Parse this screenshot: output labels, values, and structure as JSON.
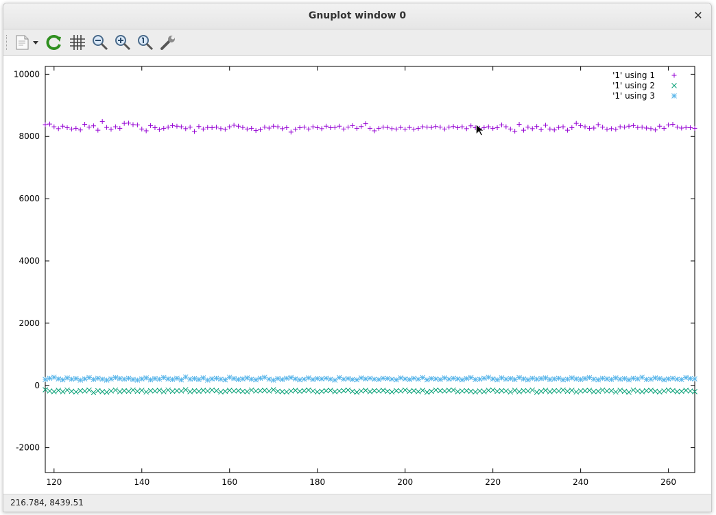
{
  "window": {
    "title": "Gnuplot window 0",
    "close_icon": "close-icon"
  },
  "toolbar": {
    "items": [
      {
        "name": "copy-clipboard-button",
        "icon": "clipboard-icon"
      },
      {
        "name": "replot-button",
        "icon": "refresh-icon"
      },
      {
        "name": "toggle-grid-button",
        "icon": "grid-icon"
      },
      {
        "name": "zoom-previous-button",
        "icon": "zoom-out-icon"
      },
      {
        "name": "zoom-next-button",
        "icon": "zoom-in-icon"
      },
      {
        "name": "autoscale-button",
        "icon": "zoom-reset-icon"
      },
      {
        "name": "settings-button",
        "icon": "wrench-icon"
      }
    ]
  },
  "status": {
    "coords": "216.784,  8439.51"
  },
  "chart_data": {
    "type": "scatter",
    "title": "",
    "xlabel": "",
    "ylabel": "",
    "xlim": [
      118,
      266
    ],
    "ylim": [
      -2800,
      10250
    ],
    "xticks": [
      120,
      140,
      160,
      180,
      200,
      220,
      240,
      260
    ],
    "yticks": [
      -2000,
      0,
      2000,
      4000,
      6000,
      8000,
      10000
    ],
    "legend_position": "top-right",
    "grid": false,
    "series": [
      {
        "name": "'1' using 1",
        "marker": "+",
        "color": "#9400d3",
        "x_start": 118,
        "x_step": 1,
        "approx_mean": 8280,
        "y": [
          8380,
          8400,
          8310,
          8250,
          8330,
          8280,
          8240,
          8260,
          8210,
          8390,
          8300,
          8340,
          8200,
          8480,
          8290,
          8230,
          8310,
          8260,
          8420,
          8430,
          8380,
          8370,
          8240,
          8180,
          8350,
          8280,
          8220,
          8260,
          8300,
          8350,
          8330,
          8310,
          8250,
          8300,
          8160,
          8320,
          8240,
          8290,
          8280,
          8300,
          8250,
          8230,
          8310,
          8360,
          8330,
          8290,
          8240,
          8260,
          8190,
          8220,
          8300,
          8270,
          8330,
          8310,
          8250,
          8280,
          8140,
          8230,
          8280,
          8300,
          8240,
          8310,
          8280,
          8250,
          8330,
          8280,
          8290,
          8330,
          8240,
          8300,
          8350,
          8260,
          8320,
          8410,
          8260,
          8180,
          8260,
          8300,
          8290,
          8250,
          8240,
          8290,
          8230,
          8290,
          8230,
          8260,
          8310,
          8300,
          8290,
          8320,
          8300,
          8240,
          8300,
          8320,
          8280,
          8310,
          8250,
          8340,
          8280,
          8260,
          8280,
          8310,
          8260,
          8280,
          8370,
          8310,
          8240,
          8170,
          8390,
          8200,
          8300,
          8250,
          8320,
          8220,
          8360,
          8240,
          8210,
          8290,
          8310,
          8200,
          8280,
          8420,
          8350,
          8310,
          8260,
          8270,
          8380,
          8300,
          8230,
          8250,
          8230,
          8310,
          8300,
          8330,
          8350,
          8290,
          8300,
          8270,
          8250,
          8210,
          8330,
          8260,
          8370,
          8390,
          8300,
          8270,
          8290,
          8280,
          8260,
          8300,
          8330,
          8310
        ]
      },
      {
        "name": "'1' using 2",
        "marker": "x",
        "color": "#009e73",
        "x_start": 118,
        "x_step": 1,
        "approx_mean": -180,
        "y": [
          -140,
          -180,
          -200,
          -160,
          -200,
          -150,
          -190,
          -210,
          -170,
          -180,
          -150,
          -230,
          -170,
          -200,
          -220,
          -180,
          -150,
          -200,
          -170,
          -190,
          -150,
          -190,
          -160,
          -210,
          -170,
          -180,
          -160,
          -200,
          -150,
          -190,
          -170,
          -180,
          -140,
          -200,
          -170,
          -190,
          -160,
          -180,
          -150,
          -170,
          -210,
          -190,
          -160,
          -180,
          -170,
          -190,
          -200,
          -150,
          -180,
          -170,
          -160,
          -180,
          -140,
          -190,
          -200,
          -210,
          -180,
          -160,
          -190,
          -170,
          -150,
          -180,
          -210,
          -190,
          -170,
          -160,
          -200,
          -180,
          -170,
          -150,
          -190,
          -220,
          -180,
          -160,
          -200,
          -170,
          -180,
          -160,
          -190,
          -210,
          -170,
          -180,
          -150,
          -190,
          -170,
          -200,
          -160,
          -220,
          -190,
          -150,
          -170,
          -180,
          -160,
          -150,
          -200,
          -180,
          -170,
          -190,
          -210,
          -180,
          -200,
          -160,
          -150,
          -190,
          -170,
          -180,
          -210,
          -160,
          -200,
          -170,
          -180,
          -150,
          -220,
          -190,
          -160,
          -200,
          -170,
          -180,
          -150,
          -190,
          -160,
          -210,
          -180,
          -170,
          -160,
          -200,
          -190,
          -150,
          -180,
          -170,
          -210,
          -160,
          -190,
          -220,
          -150,
          -180,
          -200,
          -170,
          -160,
          -190,
          -210,
          -180,
          -150,
          -170,
          -200,
          -190,
          -160,
          -180,
          -200,
          -170,
          -190,
          -160
        ]
      },
      {
        "name": "'1' using 3",
        "marker": "*",
        "color": "#56b4e9",
        "x_start": 118,
        "x_step": 1,
        "approx_mean": 210,
        "y": [
          190,
          230,
          260,
          210,
          180,
          240,
          200,
          220,
          170,
          210,
          250,
          190,
          230,
          200,
          170,
          210,
          250,
          220,
          200,
          230,
          190,
          170,
          210,
          240,
          180,
          220,
          200,
          250,
          210,
          190,
          230,
          180,
          270,
          200,
          220,
          190,
          240,
          170,
          210,
          230,
          200,
          180,
          260,
          220,
          190,
          210,
          240,
          200,
          180,
          230,
          260,
          200,
          170,
          220,
          190,
          230,
          250,
          210,
          180,
          200,
          240,
          190,
          220,
          210,
          230,
          200,
          170,
          250,
          200,
          220,
          190,
          180,
          240,
          210,
          230,
          200,
          190,
          230,
          220,
          200,
          180,
          240,
          210,
          190,
          230,
          200,
          250,
          180,
          220,
          210,
          190,
          240,
          200,
          230,
          210,
          180,
          220,
          250,
          190,
          200,
          230,
          260,
          210,
          180,
          240,
          200,
          220,
          190,
          250,
          210,
          180,
          230,
          200,
          220,
          240,
          190,
          210,
          230,
          180,
          200,
          240,
          210,
          190,
          220,
          250,
          200,
          180,
          230,
          210,
          190,
          240,
          200,
          220,
          180,
          230,
          210,
          260,
          190,
          200,
          240,
          220,
          180,
          210,
          230,
          200,
          190,
          250,
          220,
          210,
          180,
          200,
          230
        ]
      }
    ]
  }
}
